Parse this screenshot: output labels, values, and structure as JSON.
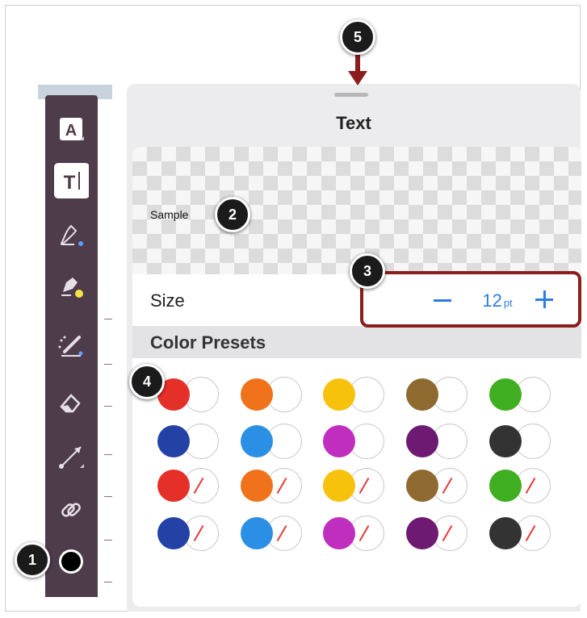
{
  "panel": {
    "title": "Text",
    "sample_text": "Sample",
    "size": {
      "label": "Size",
      "value": "12",
      "unit": "pt",
      "minus_label": "−",
      "plus_label": "+"
    },
    "presets_header": "Color Presets"
  },
  "colors": {
    "toolbar_bg": "#4e3c4b",
    "accent_blue": "#2a7de1",
    "highlight_red": "#8c1d1d"
  },
  "toolbar": {
    "tools": [
      {
        "name": "text-style-icon",
        "label": "A"
      },
      {
        "name": "text-tool-icon",
        "label": "T"
      },
      {
        "name": "pen-icon"
      },
      {
        "name": "highlighter-icon"
      },
      {
        "name": "magic-pen-icon"
      },
      {
        "name": "eraser-icon"
      },
      {
        "name": "line-arrow-icon"
      },
      {
        "name": "link-icon"
      },
      {
        "name": "color-circle-icon"
      }
    ]
  },
  "presets": {
    "rows": [
      [
        "#e53029",
        "#f0721b",
        "#f6c20c",
        "#8f6a30",
        "#3fae20"
      ],
      [
        "#2442a6",
        "#2b8fe6",
        "#c02ec0",
        "#6e1a72",
        "#333333"
      ],
      [
        "#e53029",
        "#f0721b",
        "#f6c20c",
        "#8f6a30",
        "#3fae20"
      ],
      [
        "#2442a6",
        "#2b8fe6",
        "#c02ec0",
        "#6e1a72",
        "#333333"
      ]
    ],
    "slashed_rows": [
      2,
      3
    ]
  },
  "callouts": [
    "1",
    "2",
    "3",
    "4",
    "5"
  ]
}
